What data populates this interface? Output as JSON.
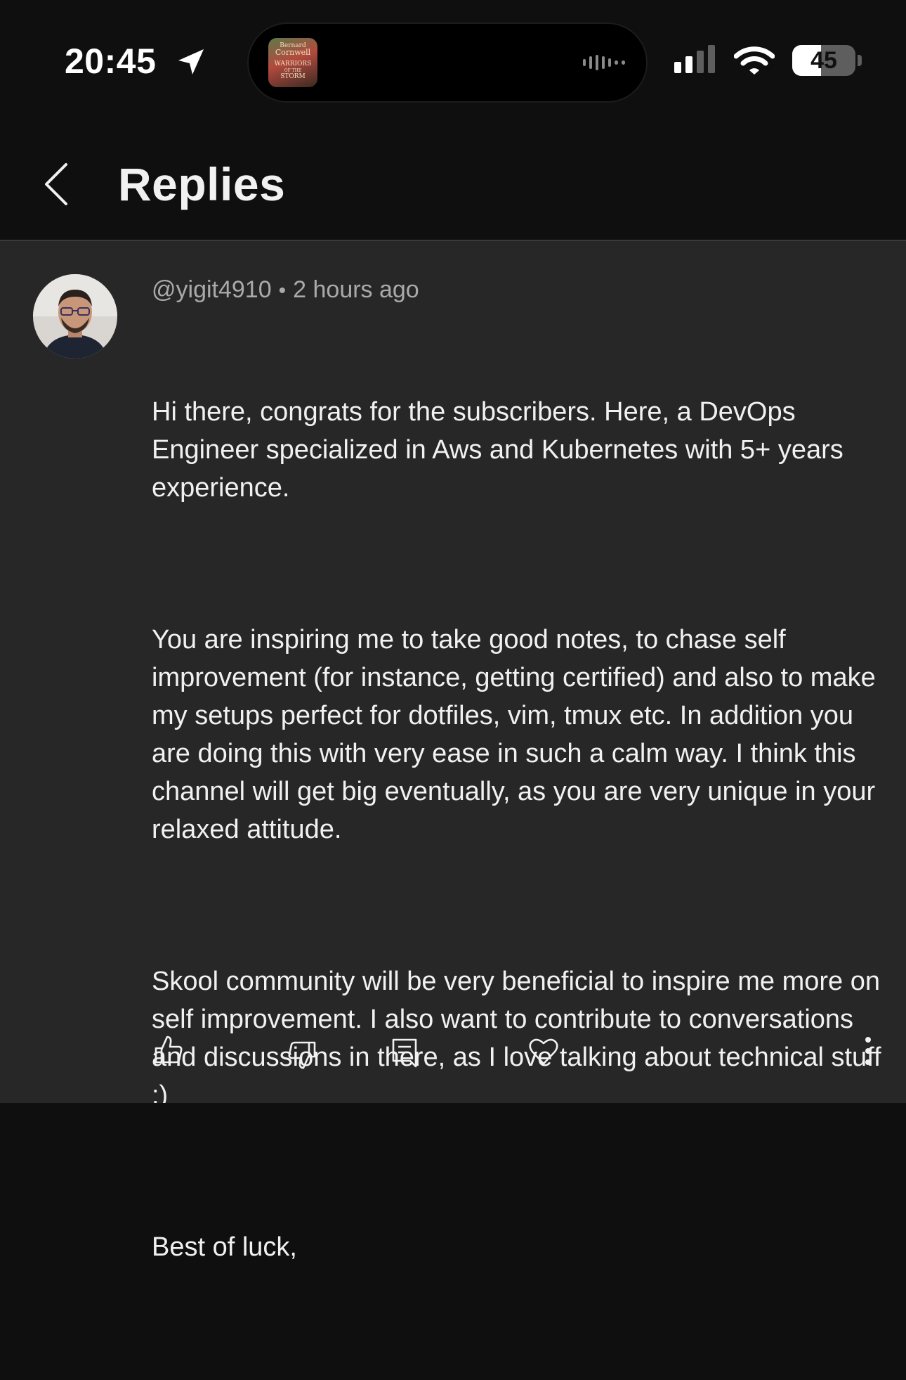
{
  "status_bar": {
    "time": "20:45",
    "battery": "45",
    "battery_level": 0.45,
    "album_art_text": [
      "Bernard",
      "Cornwell",
      "WARRIORS",
      "OF THE",
      "STORM"
    ]
  },
  "header": {
    "title": "Replies"
  },
  "comment": {
    "author": "@yigit4910",
    "separator": "•",
    "time_ago": "2 hours ago",
    "paragraphs": [
      "Hi there, congrats for the subscribers. Here, a DevOps Engineer specialized in Aws and Kubernetes with 5+ years experience.",
      "You are inspiring me to take good notes, to chase self improvement (for instance, getting certified) and also to make my setups perfect for dotfiles, vim, tmux etc. In addition you are doing this with very ease in such a calm way. I think this channel will get big eventually, as you are very unique in your relaxed attitude.",
      "Skool community will be very beneficial to inspire me more on self improvement. I also want to contribute to conversations and discussions in there, as I love talking about technical stuff :)",
      "Best of luck,"
    ]
  },
  "icons": {
    "back": "chevron-left-icon",
    "like": "thumbs-up-icon",
    "dislike": "thumbs-down-icon",
    "reply": "reply-comment-icon",
    "heart": "heart-icon",
    "more": "more-vertical-icon"
  },
  "colors": {
    "background": "#0f0f0f",
    "card": "#272727",
    "text": "#f1f1f1",
    "muted": "#aaaaaa"
  }
}
